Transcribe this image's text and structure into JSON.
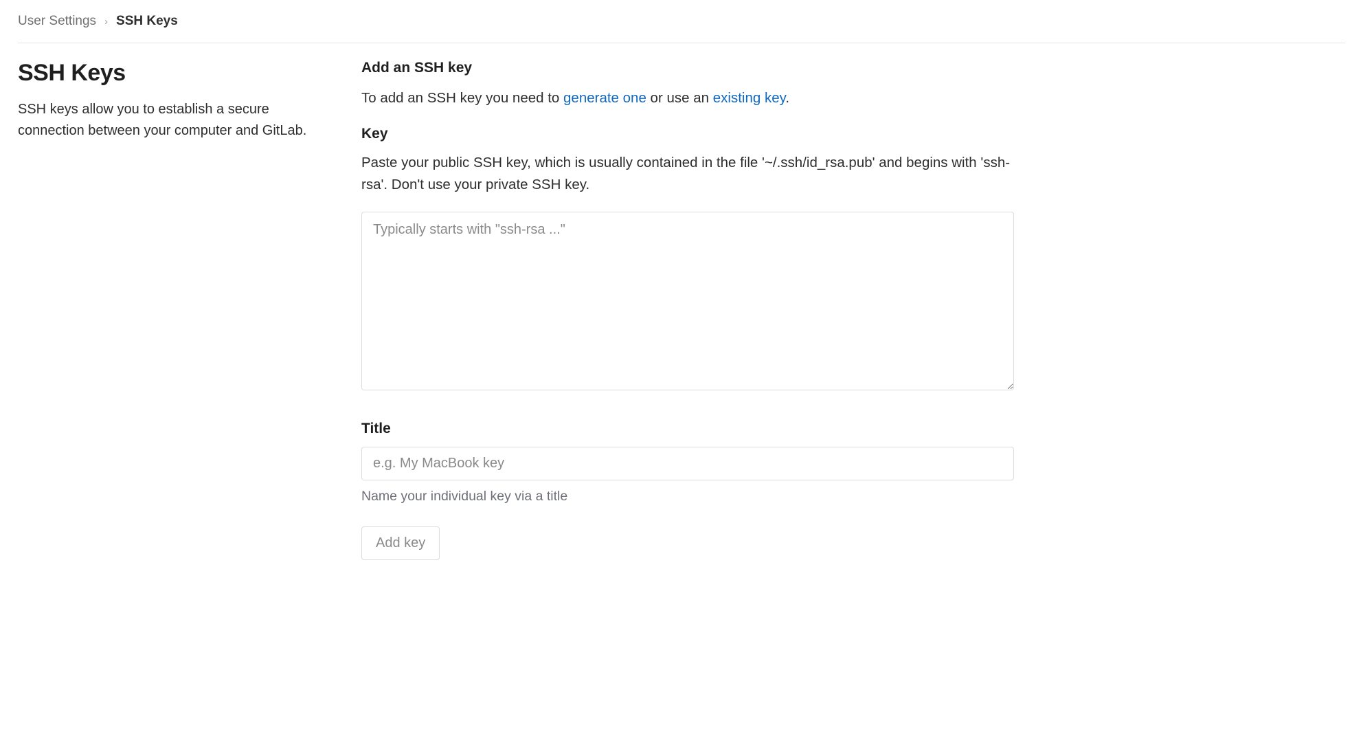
{
  "breadcrumb": {
    "parent": "User Settings",
    "current": "SSH Keys"
  },
  "sidebar": {
    "title": "SSH Keys",
    "description": "SSH keys allow you to establish a secure connection between your computer and GitLab."
  },
  "main": {
    "add_heading": "Add an SSH key",
    "add_text_prefix": "To add an SSH key you need to ",
    "link_generate": "generate one",
    "add_text_middle": " or use an ",
    "link_existing": "existing key",
    "add_text_suffix": ".",
    "key_label": "Key",
    "key_help": "Paste your public SSH key, which is usually contained in the file '~/.ssh/id_rsa.pub' and begins with 'ssh-rsa'. Don't use your private SSH key.",
    "key_placeholder": "Typically starts with \"ssh-rsa ...\"",
    "title_label": "Title",
    "title_placeholder": "e.g. My MacBook key",
    "title_help": "Name your individual key via a title",
    "add_button": "Add key"
  }
}
